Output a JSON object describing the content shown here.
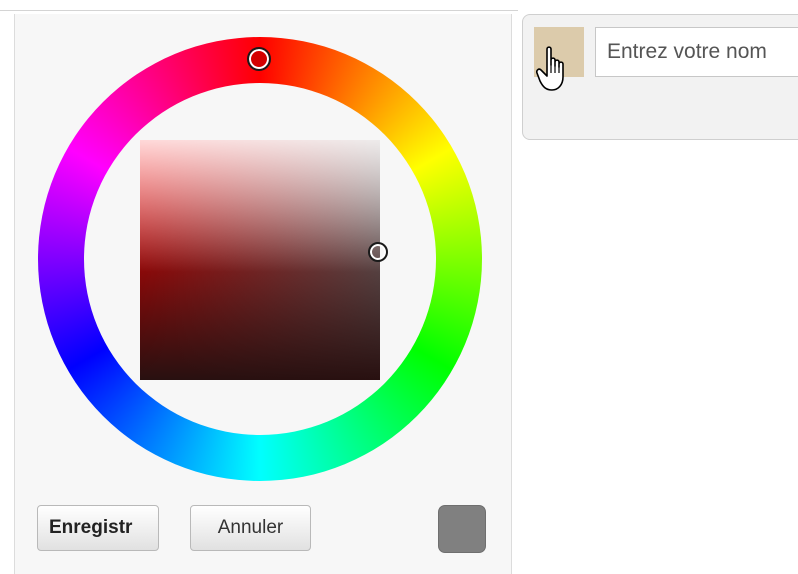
{
  "color_picker": {
    "save_label": "Enregistr",
    "cancel_label": "Annuler",
    "selected_hue": "#d40000",
    "preview_color": "#808080"
  },
  "form": {
    "swatch_color": "#dccbab",
    "name_placeholder": "Entrez votre nom"
  },
  "icons": {
    "cursor": "hand-pointer-icon"
  }
}
